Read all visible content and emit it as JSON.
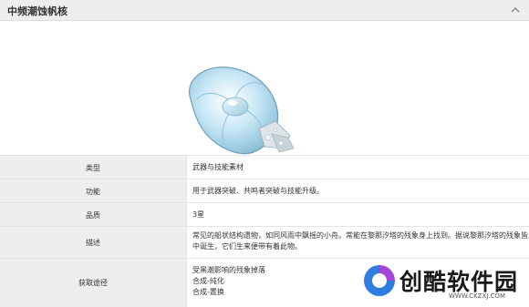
{
  "header": {
    "title": "中频潮蚀帆核"
  },
  "details": {
    "type": {
      "label": "类型",
      "value": "武器与技能素材"
    },
    "function": {
      "label": "功能",
      "value": "用于武器突破、共鸣者突破与技能升级。"
    },
    "rarity": {
      "label": "品质",
      "value": "3星"
    },
    "description": {
      "label": "描述",
      "lines": [
        "常见的船状结构遗物，如同风雨中飘摇的小舟。常能在黎那汐塔的残象身上找到。据说黎那汐塔的残象皆从黑潮",
        "中诞生，它们生来便带有着此物。"
      ]
    },
    "source": {
      "label": "获取途径",
      "items": [
        "受黑潮影响的残象掉落",
        "合成-纯化",
        "合成-置换"
      ]
    }
  },
  "watermark": {
    "name": "创酷软件园",
    "url": "WWW.CKZXJ.COM"
  },
  "colors": {
    "header_bg": "#eeeeee",
    "label_bg": "#eeeeee",
    "border": "#e4e4e4",
    "wm_blue": "#2f7de1",
    "wm_purple": "#a347d9"
  },
  "icons": {
    "collapse": "chevron-up-icon"
  }
}
